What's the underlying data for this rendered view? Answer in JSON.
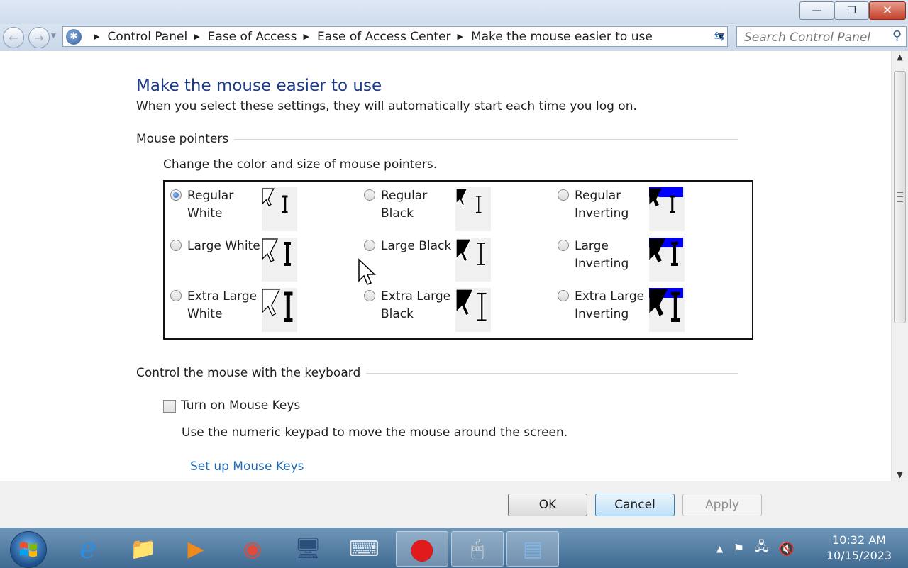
{
  "window": {
    "minimize_glyph": "—",
    "maximize_glyph": "❐",
    "close_glyph": "✕"
  },
  "navigation": {
    "back_glyph": "←",
    "forward_glyph": "→",
    "breadcrumbs": [
      {
        "label": "Control Panel"
      },
      {
        "label": "Ease of Access"
      },
      {
        "label": "Ease of Access Center"
      },
      {
        "label": "Make the mouse easier to use"
      }
    ],
    "breadcrumb_separator": "▶",
    "refresh_glyph": "⇆",
    "search_placeholder": "Search Control Panel",
    "search_glyph": "⚲"
  },
  "page": {
    "title": "Make the mouse easier to use",
    "subtitle": "When you select these settings, they will automatically start each time you log on."
  },
  "mouse_pointers": {
    "heading": "Mouse pointers",
    "description": "Change the color and size of mouse pointers.",
    "options": [
      {
        "label": "Regular White",
        "checked": true,
        "style": "white",
        "size": "regular"
      },
      {
        "label": "Regular Black",
        "checked": false,
        "style": "black",
        "size": "regular"
      },
      {
        "label": "Regular Inverting",
        "checked": false,
        "style": "inverting",
        "size": "regular"
      },
      {
        "label": "Large White",
        "checked": false,
        "style": "white",
        "size": "large"
      },
      {
        "label": "Large Black",
        "checked": false,
        "style": "black",
        "size": "large"
      },
      {
        "label": "Large Inverting",
        "checked": false,
        "style": "inverting",
        "size": "large"
      },
      {
        "label": "Extra Large White",
        "checked": false,
        "style": "white",
        "size": "extra-large"
      },
      {
        "label": "Extra Large Black",
        "checked": false,
        "style": "black",
        "size": "extra-large"
      },
      {
        "label": "Extra Large Inverting",
        "checked": false,
        "style": "inverting",
        "size": "extra-large"
      }
    ]
  },
  "keyboard_control": {
    "heading": "Control the mouse with the keyboard",
    "mouse_keys_label": "Turn on Mouse Keys",
    "mouse_keys_checked": false,
    "mouse_keys_description": "Use the numeric keypad to move the mouse around the screen.",
    "setup_link": "Set up Mouse Keys"
  },
  "buttons": {
    "ok": "OK",
    "cancel": "Cancel",
    "apply": "Apply",
    "apply_enabled": false
  },
  "taskbar": {
    "apps": [
      {
        "name": "internet-explorer",
        "glyph": "e",
        "color": "#2a8fe0"
      },
      {
        "name": "windows-explorer",
        "glyph": "📁",
        "color": "#f3c54a"
      },
      {
        "name": "media-player",
        "glyph": "▶",
        "color": "#f08a1c"
      },
      {
        "name": "chrome",
        "glyph": "◉",
        "color": "#e04a3a"
      },
      {
        "name": "remote-desktop",
        "glyph": "🖥",
        "color": "#2a4f7a"
      },
      {
        "name": "on-screen-keyboard",
        "glyph": "⌨",
        "color": "#dfe7f0"
      },
      {
        "name": "screen-recorder",
        "glyph": "●",
        "color": "#e11b1b"
      },
      {
        "name": "mouse-settings",
        "glyph": "🖱",
        "color": "#e5e5e5"
      },
      {
        "name": "control-panel",
        "glyph": "▤",
        "color": "#7fb6e6"
      }
    ],
    "clock_time": "10:32 AM",
    "clock_date": "10/15/2023",
    "tray": {
      "show_hidden_glyph": "▲",
      "action_center_glyph": "⚑",
      "network_glyph": "🖧",
      "volume_glyph": "🔇"
    }
  },
  "colors": {
    "title_blue": "#1e3b8a",
    "link_blue": "#1f67b4",
    "inverting_blue": "#0000ff",
    "inverting_yellow": "#ffff00"
  }
}
